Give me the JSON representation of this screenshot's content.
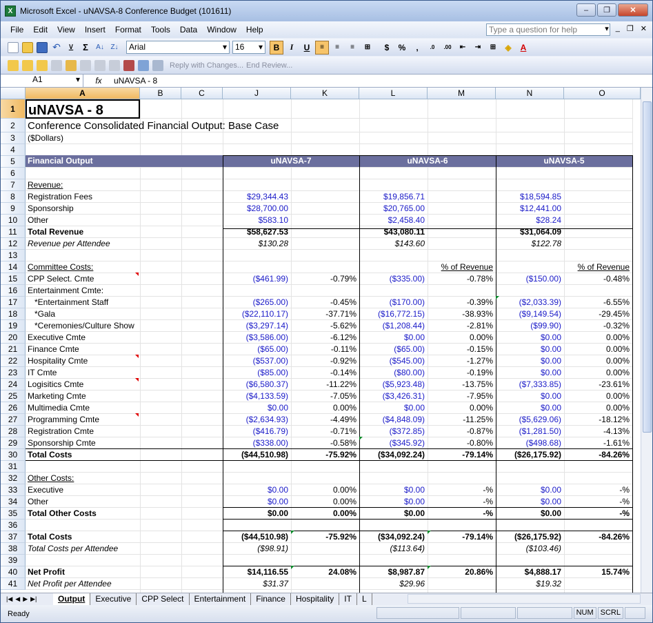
{
  "window": {
    "title": "Microsoft Excel - uNAVSA-8 Conference Budget (101611)",
    "minimize": "–",
    "restore": "❐",
    "close": "✕"
  },
  "menu": {
    "items": [
      "File",
      "Edit",
      "View",
      "Insert",
      "Format",
      "Tools",
      "Data",
      "Window",
      "Help"
    ],
    "help_placeholder": "Type a question for help",
    "right_controls": [
      "▾",
      "_",
      "❐",
      "✕"
    ]
  },
  "toolbar": {
    "font": "Arial",
    "font_size": "16",
    "reply_label": "Reply with Changes...",
    "end_review_label": "End Review..."
  },
  "formula_bar": {
    "cell_ref": "A1",
    "fx_label": "fx",
    "value": "uNAVSA - 8"
  },
  "columns": [
    "A",
    "B",
    "C",
    "J",
    "K",
    "L",
    "M",
    "N",
    "O"
  ],
  "rows": [
    "1",
    "2",
    "3",
    "4",
    "5",
    "6",
    "7",
    "8",
    "9",
    "10",
    "11",
    "12",
    "13",
    "14",
    "15",
    "16",
    "17",
    "18",
    "19",
    "20",
    "21",
    "22",
    "23",
    "24",
    "25",
    "26",
    "27",
    "28",
    "29",
    "30",
    "31",
    "32",
    "33",
    "34",
    "35",
    "36",
    "37",
    "38",
    "39",
    "40",
    "41"
  ],
  "sheet": {
    "r1": {
      "a": "uNAVSA - 8"
    },
    "r2": {
      "a": "Conference Consolidated Financial Output: Base Case"
    },
    "r3": {
      "a": "($Dollars)"
    },
    "r5": {
      "a": "Financial Output",
      "j": "uNAVSA-7",
      "l": "uNAVSA-6",
      "n": "uNAVSA-5"
    },
    "r7": {
      "a": "Revenue:"
    },
    "r8": {
      "a": "Registration Fees",
      "j": "$29,344.43",
      "l": "$19,856.71",
      "n": "$18,594.85"
    },
    "r9": {
      "a": "Sponsorship",
      "j": "$28,700.00",
      "l": "$20,765.00",
      "n": "$12,441.00"
    },
    "r10": {
      "a": "Other",
      "j": "$583.10",
      "l": "$2,458.40",
      "n": "$28.24"
    },
    "r11": {
      "a": "Total Revenue",
      "j": "$58,627.53",
      "l": "$43,080.11",
      "n": "$31,064.09"
    },
    "r12": {
      "a": "Revenue per Attendee",
      "j": "$130.28",
      "l": "$143.60",
      "n": "$122.78"
    },
    "r14": {
      "a": "Committee Costs:",
      "m": "% of Revenue",
      "o": "% of Revenue"
    },
    "r15": {
      "a": "CPP Select. Cmte",
      "j": "($461.99)",
      "k": "-0.79%",
      "l": "($335.00)",
      "m": "-0.78%",
      "n": "($150.00)",
      "o": "-0.48%"
    },
    "r16": {
      "a": "Entertainment Cmte:"
    },
    "r17": {
      "a": "*Entertainment Staff",
      "j": "($265.00)",
      "k": "-0.45%",
      "l": "($170.00)",
      "m": "-0.39%",
      "n": "($2,033.39)",
      "o": "-6.55%"
    },
    "r18": {
      "a": "*Gala",
      "j": "($22,110.17)",
      "k": "-37.71%",
      "l": "($16,772.15)",
      "m": "-38.93%",
      "n": "($9,149.54)",
      "o": "-29.45%"
    },
    "r19": {
      "a": "*Ceremonies/Culture Show",
      "j": "($3,297.14)",
      "k": "-5.62%",
      "l": "($1,208.44)",
      "m": "-2.81%",
      "n": "($99.90)",
      "o": "-0.32%"
    },
    "r20": {
      "a": "Executive Cmte",
      "j": "($3,586.00)",
      "k": "-6.12%",
      "l": "$0.00",
      "m": "0.00%",
      "n": "$0.00",
      "o": "0.00%"
    },
    "r21": {
      "a": "Finance Cmte",
      "j": "($65.00)",
      "k": "-0.11%",
      "l": "($65.00)",
      "m": "-0.15%",
      "n": "$0.00",
      "o": "0.00%"
    },
    "r22": {
      "a": "Hospitality Cmte",
      "j": "($537.00)",
      "k": "-0.92%",
      "l": "($545.00)",
      "m": "-1.27%",
      "n": "$0.00",
      "o": "0.00%"
    },
    "r23": {
      "a": "IT Cmte",
      "j": "($85.00)",
      "k": "-0.14%",
      "l": "($80.00)",
      "m": "-0.19%",
      "n": "$0.00",
      "o": "0.00%"
    },
    "r24": {
      "a": "Logisitics Cmte",
      "j": "($6,580.37)",
      "k": "-11.22%",
      "l": "($5,923.48)",
      "m": "-13.75%",
      "n": "($7,333.85)",
      "o": "-23.61%"
    },
    "r25": {
      "a": "Marketing Cmte",
      "j": "($4,133.59)",
      "k": "-7.05%",
      "l": "($3,426.31)",
      "m": "-7.95%",
      "n": "$0.00",
      "o": "0.00%"
    },
    "r26": {
      "a": "Multimedia Cmte",
      "j": "$0.00",
      "k": "0.00%",
      "l": "$0.00",
      "m": "0.00%",
      "n": "$0.00",
      "o": "0.00%"
    },
    "r27": {
      "a": "Programming Cmte",
      "j": "($2,634.93)",
      "k": "-4.49%",
      "l": "($4,848.09)",
      "m": "-11.25%",
      "n": "($5,629.06)",
      "o": "-18.12%"
    },
    "r28": {
      "a": "Registration Cmte",
      "j": "($416.79)",
      "k": "-0.71%",
      "l": "($372.85)",
      "m": "-0.87%",
      "n": "($1,281.50)",
      "o": "-4.13%"
    },
    "r29": {
      "a": "Sponsorship Cmte",
      "j": "($338.00)",
      "k": "-0.58%",
      "l": "($345.92)",
      "m": "-0.80%",
      "n": "($498.68)",
      "o": "-1.61%"
    },
    "r30": {
      "a": "Total Costs",
      "j": "($44,510.98)",
      "k": "-75.92%",
      "l": "($34,092.24)",
      "m": "-79.14%",
      "n": "($26,175.92)",
      "o": "-84.26%"
    },
    "r32": {
      "a": "Other Costs:"
    },
    "r33": {
      "a": "Executive",
      "j": "$0.00",
      "k": "0.00%",
      "l": "$0.00",
      "m": "-%",
      "n": "$0.00",
      "o": "-%"
    },
    "r34": {
      "a": "Other",
      "j": "$0.00",
      "k": "0.00%",
      "l": "$0.00",
      "m": "-%",
      "n": "$0.00",
      "o": "-%"
    },
    "r35": {
      "a": "Total Other Costs",
      "j": "$0.00",
      "k": "0.00%",
      "l": "$0.00",
      "m": "-%",
      "n": "$0.00",
      "o": "-%"
    },
    "r37": {
      "a": "Total Costs",
      "j": "($44,510.98)",
      "k": "-75.92%",
      "l": "($34,092.24)",
      "m": "-79.14%",
      "n": "($26,175.92)",
      "o": "-84.26%"
    },
    "r38": {
      "a": "Total Costs per Attendee",
      "j": "($98.91)",
      "l": "($113.64)",
      "n": "($103.46)"
    },
    "r40": {
      "a": "Net Profit",
      "j": "$14,116.55",
      "k": "24.08%",
      "l": "$8,987.87",
      "m": "20.86%",
      "n": "$4,888.17",
      "o": "15.74%"
    },
    "r41": {
      "a": "Net Profit per Attendee",
      "j": "$31.37",
      "l": "$29.96",
      "n": "$19.32"
    }
  },
  "sheet_tabs": [
    "Output",
    "Executive",
    "CPP Select",
    "Entertainment",
    "Finance",
    "Hospitality",
    "IT",
    "L"
  ],
  "status": {
    "ready": "Ready",
    "num": "NUM",
    "scrl": "SCRL"
  },
  "colors": {
    "header_band": "#6b6f9e",
    "input_blue": "#1a1ac8",
    "selection": "#f0b961"
  }
}
